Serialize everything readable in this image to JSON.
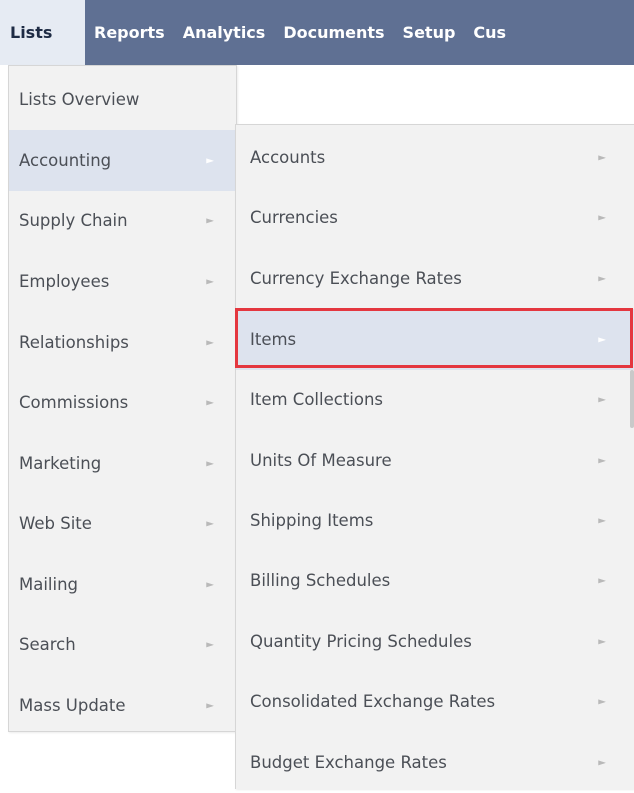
{
  "nav": {
    "items": [
      {
        "label": "Lists",
        "active": true
      },
      {
        "label": "Reports"
      },
      {
        "label": "Analytics"
      },
      {
        "label": "Documents"
      },
      {
        "label": "Setup"
      },
      {
        "label": "Cus"
      }
    ]
  },
  "lists_menu": {
    "items": [
      {
        "label": "Lists Overview",
        "has_submenu": false
      },
      {
        "label": "Accounting",
        "has_submenu": true,
        "hovered": true
      },
      {
        "label": "Supply Chain",
        "has_submenu": true
      },
      {
        "label": "Employees",
        "has_submenu": true
      },
      {
        "label": "Relationships",
        "has_submenu": true
      },
      {
        "label": "Commissions",
        "has_submenu": true
      },
      {
        "label": "Marketing",
        "has_submenu": true
      },
      {
        "label": "Web Site",
        "has_submenu": true
      },
      {
        "label": "Mailing",
        "has_submenu": true
      },
      {
        "label": "Search",
        "has_submenu": true
      },
      {
        "label": "Mass Update",
        "has_submenu": true
      }
    ]
  },
  "accounting_menu": {
    "items": [
      {
        "label": "Accounts",
        "has_submenu": true
      },
      {
        "label": "Currencies",
        "has_submenu": true
      },
      {
        "label": "Currency Exchange Rates",
        "has_submenu": true
      },
      {
        "label": "Items",
        "has_submenu": true,
        "hovered": true,
        "highlighted": true
      },
      {
        "label": "Item Collections",
        "has_submenu": true
      },
      {
        "label": "Units Of Measure",
        "has_submenu": true
      },
      {
        "label": "Shipping Items",
        "has_submenu": true
      },
      {
        "label": "Billing Schedules",
        "has_submenu": true
      },
      {
        "label": "Quantity Pricing Schedules",
        "has_submenu": true
      },
      {
        "label": "Consolidated Exchange Rates",
        "has_submenu": true
      },
      {
        "label": "Budget Exchange Rates",
        "has_submenu": true
      }
    ]
  },
  "icons": {
    "submenu_arrow": "triangle-right-icon"
  },
  "colors": {
    "nav_bg": "#5f7093",
    "nav_active_bg": "#e6ebf3",
    "menu_bg": "#f2f2f2",
    "hover_bg": "#dde3ee",
    "highlight_border": "#e4373f"
  }
}
